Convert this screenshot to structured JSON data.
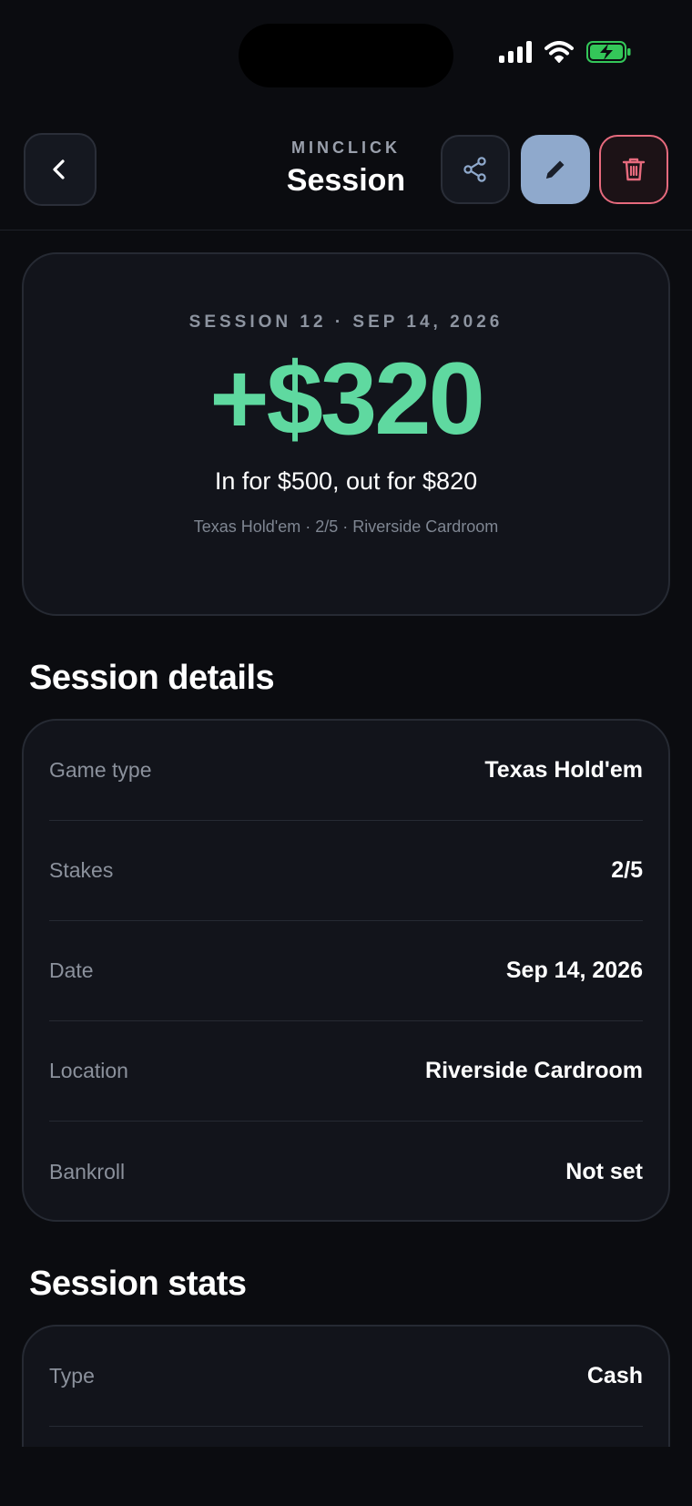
{
  "header": {
    "brand": "MINCLICK",
    "title": "Session"
  },
  "hero": {
    "kicker": "SESSION 12 · SEP 14, 2026",
    "amount": "+$320",
    "in_out": "In for $500, out for $820",
    "meta": "Texas Hold'em · 2/5 · Riverside Cardroom"
  },
  "details": {
    "title": "Session details",
    "rows": [
      {
        "label": "Game type",
        "value": "Texas Hold'em"
      },
      {
        "label": "Stakes",
        "value": "2/5"
      },
      {
        "label": "Date",
        "value": "Sep 14, 2026"
      },
      {
        "label": "Location",
        "value": "Riverside Cardroom"
      },
      {
        "label": "Bankroll",
        "value": "Not set"
      }
    ]
  },
  "stats": {
    "title": "Session stats",
    "rows": [
      {
        "label": "Type",
        "value": "Cash"
      }
    ]
  },
  "colors": {
    "profit": "#5fd9a0",
    "edit_button": "#8fa9cc",
    "delete_border": "#e66a7d",
    "battery": "#34c759"
  },
  "icons": {
    "back": "chevron-left-icon",
    "share": "share-icon",
    "edit": "pencil-icon",
    "delete": "trash-icon"
  }
}
